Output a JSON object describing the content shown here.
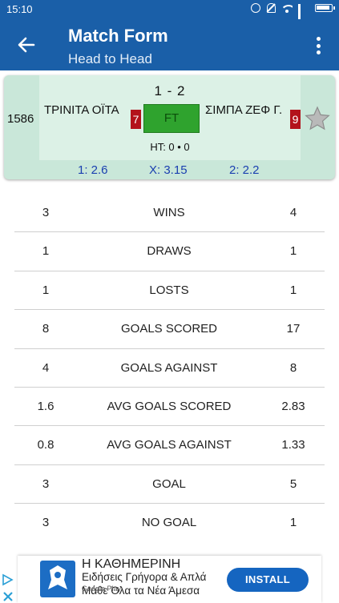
{
  "status_bar": {
    "time": "15:10"
  },
  "app_bar": {
    "title": "Match Form",
    "subtitle": "Head to Head"
  },
  "match": {
    "id": "1586",
    "score": "1  -  2",
    "home_team": "ΤΡΙΝΙΤΑ ΟΪΤΑ",
    "away_team": "ΣΙΜΠΑ ΖΕΦ Γ.",
    "home_rank": "7",
    "away_rank": "9",
    "status": "FT",
    "halftime": "HT: 0 • 0",
    "odds": {
      "home": "1: 2.6",
      "draw": "X: 3.15",
      "away": "2: 2.2"
    },
    "colors": {
      "card": "#c9e7d9",
      "status": "#2fa32e",
      "rank": "#b3121b",
      "odds": "#1a3fb0"
    }
  },
  "stats": [
    {
      "home": "3",
      "label": "WINS",
      "away": "4"
    },
    {
      "home": "1",
      "label": "DRAWS",
      "away": "1"
    },
    {
      "home": "1",
      "label": "LOSTS",
      "away": "1"
    },
    {
      "home": "8",
      "label": "GOALS SCORED",
      "away": "17"
    },
    {
      "home": "4",
      "label": "GOALS AGAINST",
      "away": "8"
    },
    {
      "home": "1.6",
      "label": "AVG GOALS SCORED",
      "away": "2.83"
    },
    {
      "home": "0.8",
      "label": "AVG GOALS AGAINST",
      "away": "1.33"
    },
    {
      "home": "3",
      "label": "GOAL",
      "away": "5"
    },
    {
      "home": "3",
      "label": "NO GOAL",
      "away": "1"
    }
  ],
  "ad": {
    "title": "Η ΚΑΘΗΜΕΡΙΝΗ",
    "text": "Ειδήσεις Γρήγορα & Απλά Μάθε Όλα τα Νέα Άμεσα",
    "store": "Google Play",
    "install_label": "INSTALL"
  },
  "accent": "#1a5fa8"
}
